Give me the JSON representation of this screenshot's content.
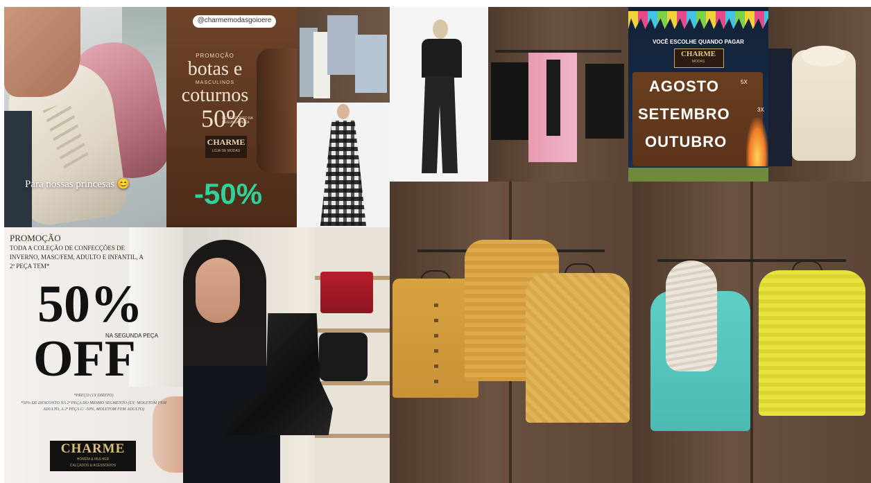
{
  "tiles": {
    "boots_kids": {
      "caption": "Para nossas princesas 😊"
    },
    "boots_promo": {
      "handle": "@charmemodasgoioere",
      "eyebrow": "PROMOÇÃO",
      "title_line1": "botas e",
      "subtitle": "MASCULINOS",
      "title_line2": "coturnos",
      "percent": "50%",
      "detail": "DE DESCONTO NA SEGUNDA PEÇA",
      "brand": "CHARME",
      "brand_sub": "LOJA DE MODAS",
      "badge": "-50%"
    },
    "payment": {
      "headline": "VOCÊ ESCOLHE QUANDO PAGAR",
      "brand": "CHARME",
      "brand_sub": "MODAS",
      "months": [
        "AGOSTO",
        "SETEMBRO",
        "OUTUBRO"
      ],
      "installments": [
        "5X",
        "3X"
      ]
    },
    "promo_off": {
      "eyebrow": "PROMOÇÃO",
      "body": "TODA A COLEÇÃO DE CONFECÇÕES DE INVERNO, MASC/FEM, ADULTO E INFANTIL, A 2ª PEÇA TEM*",
      "percent": "50%",
      "percent_sub": "NA SEGUNDA PEÇA",
      "off": "OFF",
      "fine1": "*PREÇO (1X DIRETO)",
      "fine2": "*50% DE DESCONTO NA 2ª PEÇA DO MESMO SEGMENTO (EX: MOLETOM FEM ADULTO, A 2ª PEÇA C/ -50%, MOLETOM FEM ADULTO)",
      "brand": "CHARME",
      "brand_sub": "HOMEM & MULHER",
      "brand_sub2": "CALÇADOS & ACESSÓRIOS"
    }
  },
  "colors": {
    "promo_brown": "#6a4128",
    "promo_green": "#2fd39a",
    "night_blue": "#13263f",
    "door_brown": "#5b4536",
    "mustard": "#d8a23f",
    "turquoise": "#56c7c0",
    "yellow": "#e6e03c"
  }
}
